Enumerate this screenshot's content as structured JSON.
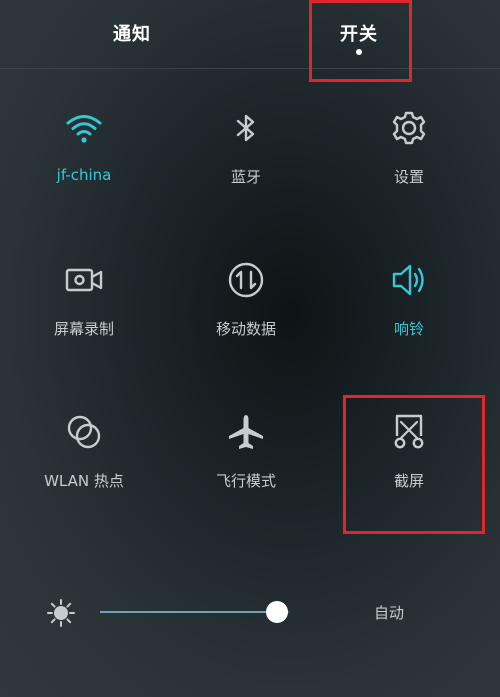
{
  "tabs": {
    "notify": "通知",
    "switch": "开关"
  },
  "tiles": [
    {
      "label": "jf-china",
      "icon": "wifi-icon",
      "active": true
    },
    {
      "label": "蓝牙",
      "icon": "bluetooth-icon",
      "active": false
    },
    {
      "label": "设置",
      "icon": "gear-icon",
      "active": false
    },
    {
      "label": "屏幕录制",
      "icon": "screen-record-icon",
      "active": false
    },
    {
      "label": "移动数据",
      "icon": "mobile-data-icon",
      "active": false
    },
    {
      "label": "响铃",
      "icon": "ring-volume-icon",
      "active": true
    },
    {
      "label": "WLAN 热点",
      "icon": "hotspot-icon",
      "active": false
    },
    {
      "label": "飞行模式",
      "icon": "airplane-icon",
      "active": false
    },
    {
      "label": "截屏",
      "icon": "screenshot-icon",
      "active": false
    }
  ],
  "brightness": {
    "level": 0.93,
    "auto_label": "自动",
    "icon": "brightness-icon"
  },
  "colors": {
    "active": "#36c7d6",
    "inactive": "#c6cdd0",
    "highlight_box": "#e0262a"
  }
}
